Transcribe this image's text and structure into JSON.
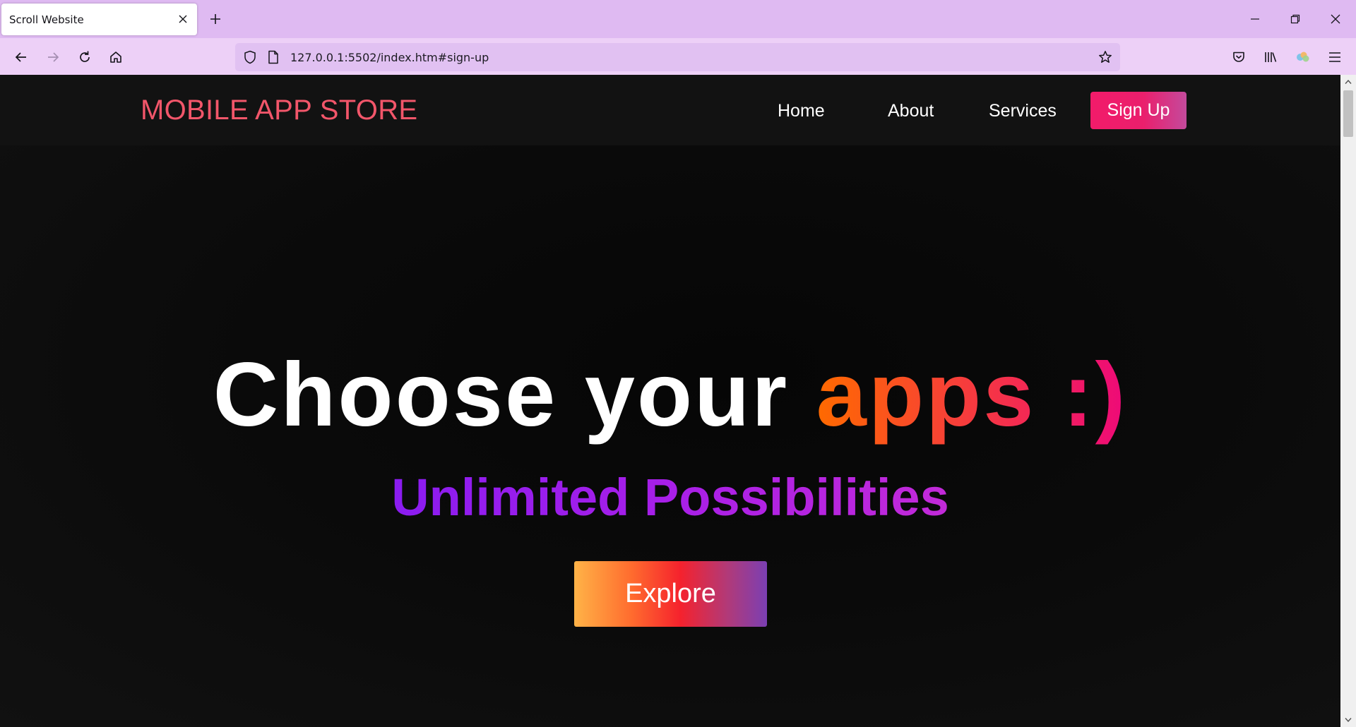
{
  "browser": {
    "tab_title": "Scroll Website",
    "url": "127.0.0.1:5502/index.htm#sign-up",
    "icons": {
      "tab_close": "close-icon",
      "new_tab": "plus-icon",
      "back": "arrow-left-icon",
      "forward": "arrow-right-icon",
      "reload": "reload-icon",
      "home": "home-icon",
      "tracking_protection": "shield-icon",
      "page_info": "page-icon",
      "bookmark": "star-icon",
      "pocket": "pocket-icon",
      "library": "library-icon",
      "account": "account-icon",
      "menu": "hamburger-icon"
    },
    "colors": {
      "tabbar": "#dfbaf2",
      "toolbar": "#edd0f7",
      "urlbar": "#e1c1f2"
    }
  },
  "site": {
    "logo": "MOBILE APP STORE",
    "nav": {
      "home": "Home",
      "about": "About",
      "services": "Services",
      "signup": "Sign Up"
    },
    "hero": {
      "title_main": "Choose your ",
      "title_accent": "apps :)",
      "subtitle": "Unlimited Possibilities",
      "cta": "Explore"
    },
    "colors": {
      "logo": "#f2566a",
      "signup_start": "#f21b6a",
      "accent_start": "#ff6a00",
      "accent_end": "#ee0979",
      "subtitle_start": "#8a1cf0",
      "subtitle_end": "#c22ad8"
    }
  }
}
